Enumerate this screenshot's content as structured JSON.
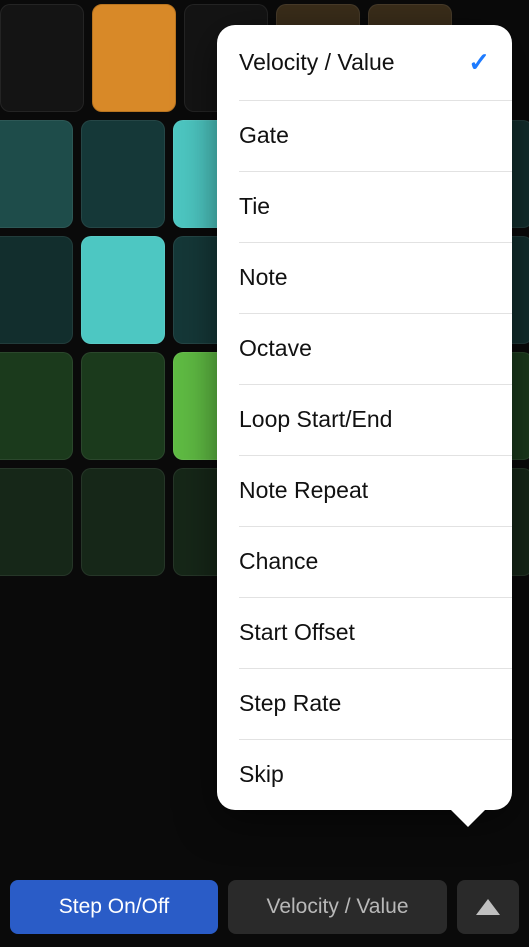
{
  "popover": {
    "items": [
      {
        "label": "Velocity / Value",
        "selected": true
      },
      {
        "label": "Gate",
        "selected": false
      },
      {
        "label": "Tie",
        "selected": false
      },
      {
        "label": "Note",
        "selected": false
      },
      {
        "label": "Octave",
        "selected": false
      },
      {
        "label": "Loop Start/End",
        "selected": false
      },
      {
        "label": "Note Repeat",
        "selected": false
      },
      {
        "label": "Chance",
        "selected": false
      },
      {
        "label": "Start Offset",
        "selected": false
      },
      {
        "label": "Step Rate",
        "selected": false
      },
      {
        "label": "Skip",
        "selected": false
      }
    ]
  },
  "bottom_bar": {
    "primary_label": "Step On/Off",
    "secondary_label": "Velocity / Value"
  },
  "grid": {
    "rows": [
      [
        "off",
        "off",
        "orange",
        "off",
        "dark-orange",
        "dark-orange"
      ],
      [
        "teal-mid",
        "teal-dim",
        "teal-bright",
        "teal-dark",
        "teal-dark",
        "teal-dark"
      ],
      [
        "teal-dark",
        "teal-bright",
        "teal-dim",
        "teal-dark",
        "teal-dark",
        "teal-dark"
      ],
      [
        "green-dim",
        "green-dim",
        "green-bright",
        "green-dim",
        "green-dim",
        "green-dim"
      ],
      [
        "green-dark",
        "green-dark",
        "green-dark",
        "green-dark",
        "green-dark",
        "green-dark"
      ]
    ]
  },
  "colors": {
    "accent_blue": "#2a5cc7",
    "check_blue": "#1e7bff"
  }
}
